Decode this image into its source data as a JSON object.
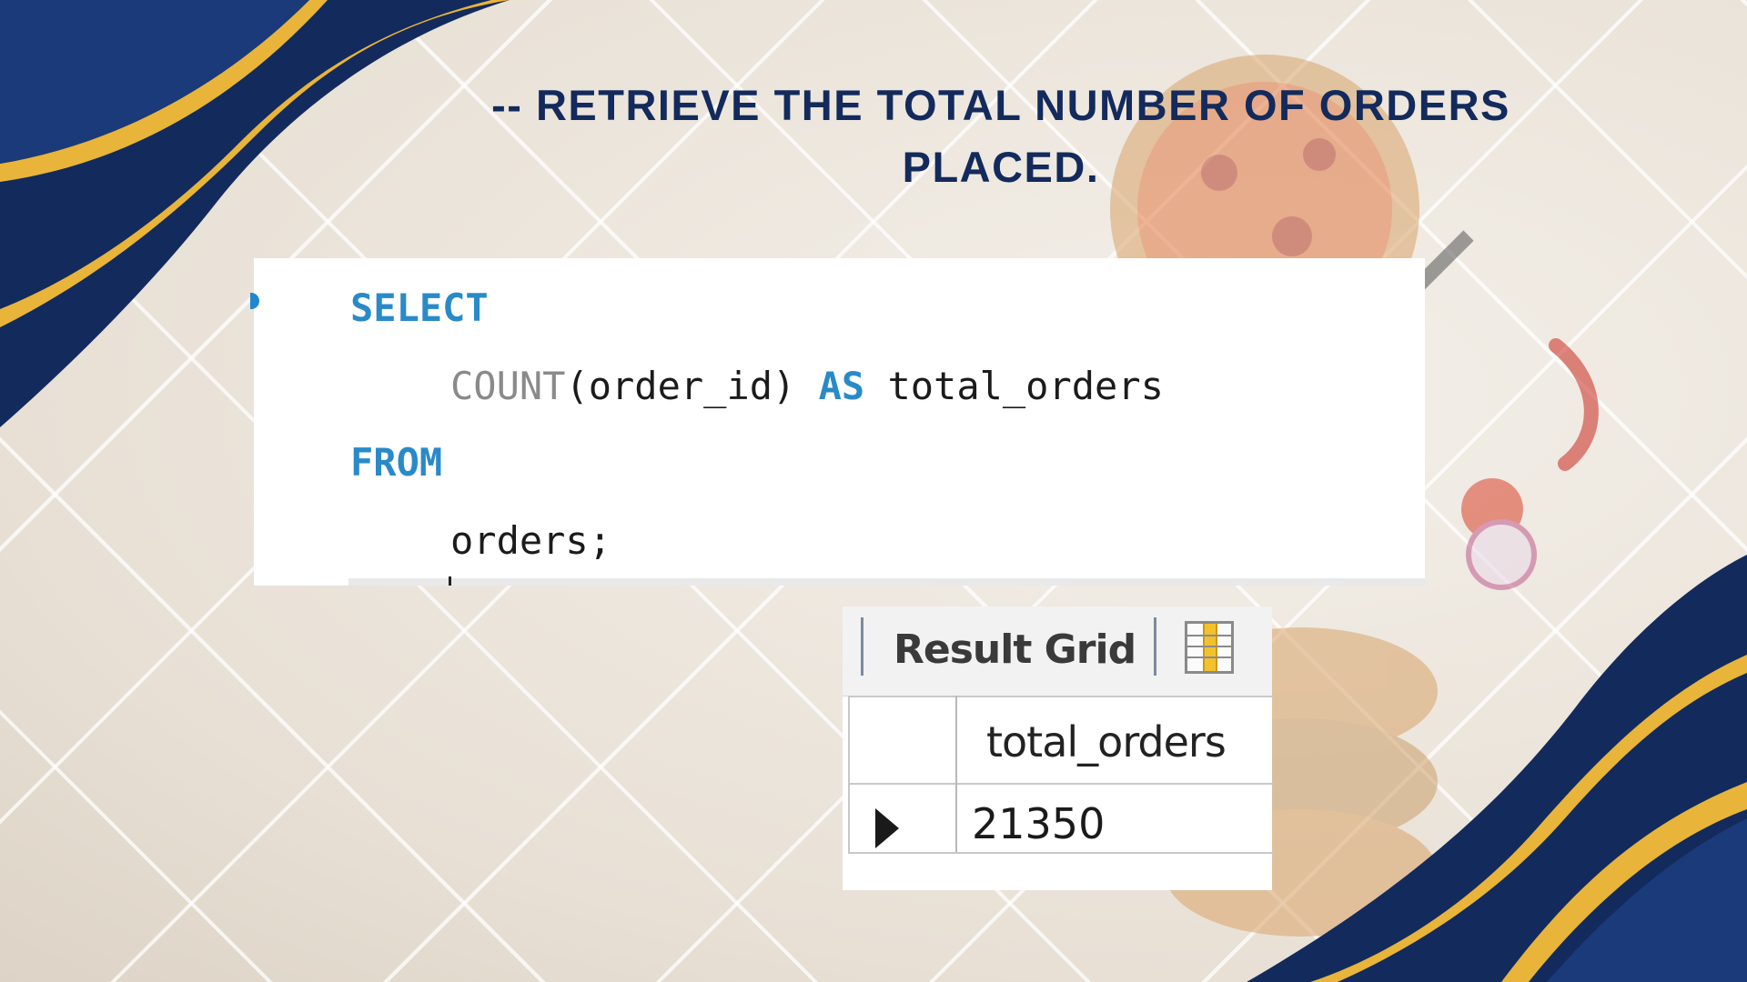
{
  "heading": {
    "line1": "-- RETRIEVE THE TOTAL NUMBER OF ORDERS",
    "line2": "PLACED."
  },
  "code": {
    "kw_select": "SELECT",
    "fn_count": "COUNT",
    "count_args": "(order_id) ",
    "kw_as": "AS",
    "alias": " total_orders",
    "kw_from": "FROM",
    "table": "orders;"
  },
  "result_grid": {
    "toolbar_label": "Result Grid",
    "toolbar_icon": "grid-view-icon",
    "columns": [
      "total_orders"
    ],
    "rows": [
      [
        "21350"
      ]
    ],
    "row_pointer_icon": "row-pointer-icon"
  },
  "decor": {
    "navy": "#132a5c",
    "gold": "#e8b43a",
    "keyword_blue": "#2a8ac8"
  }
}
